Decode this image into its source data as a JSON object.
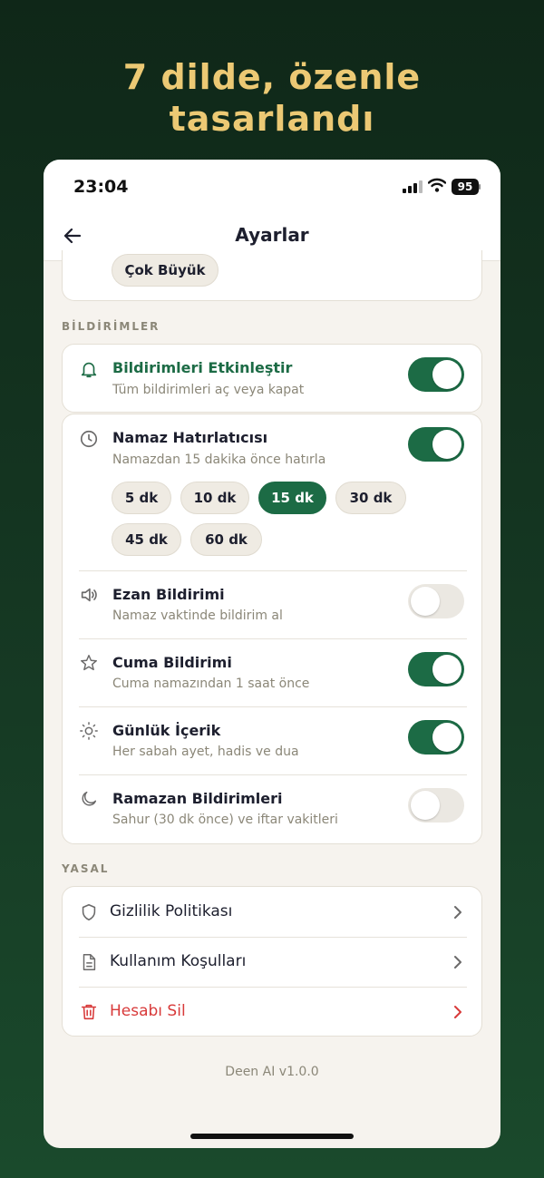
{
  "promo": {
    "line1": "7 dilde, özenle",
    "line2": "tasarlandı"
  },
  "status_bar": {
    "time": "23:04",
    "battery": "95"
  },
  "nav": {
    "title": "Ayarlar"
  },
  "font_size": {
    "option": "Çok Büyük"
  },
  "notifications": {
    "section_label": "BİLDİRİMLER",
    "enable": {
      "title": "Bildirimleri Etkinleştir",
      "subtitle": "Tüm bildirimleri aç veya kapat",
      "on": true
    },
    "prayer_reminder": {
      "title": "Namaz Hatırlatıcısı",
      "subtitle": "Namazdan 15 dakika önce hatırla",
      "on": true,
      "options": [
        "5 dk",
        "10 dk",
        "15 dk",
        "30 dk",
        "45 dk",
        "60 dk"
      ],
      "selected": "15 dk"
    },
    "adhan": {
      "title": "Ezan Bildirimi",
      "subtitle": "Namaz vaktinde bildirim al",
      "on": false
    },
    "friday": {
      "title": "Cuma Bildirimi",
      "subtitle": "Cuma namazından 1 saat önce",
      "on": true
    },
    "daily": {
      "title": "Günlük İçerik",
      "subtitle": "Her sabah ayet, hadis ve dua",
      "on": true
    },
    "ramadan": {
      "title": "Ramazan Bildirimleri",
      "subtitle": "Sahur (30 dk önce) ve iftar vakitleri",
      "on": false
    }
  },
  "legal": {
    "section_label": "YASAL",
    "privacy": "Gizlilik Politikası",
    "terms": "Kullanım Koşulları",
    "delete_account": "Hesabı Sil"
  },
  "version": "Deen AI v1.0.0",
  "colors": {
    "accent": "#1c6b45",
    "danger": "#d83a3a",
    "promo_text": "#ecc974",
    "background": "#f6f3ee"
  }
}
